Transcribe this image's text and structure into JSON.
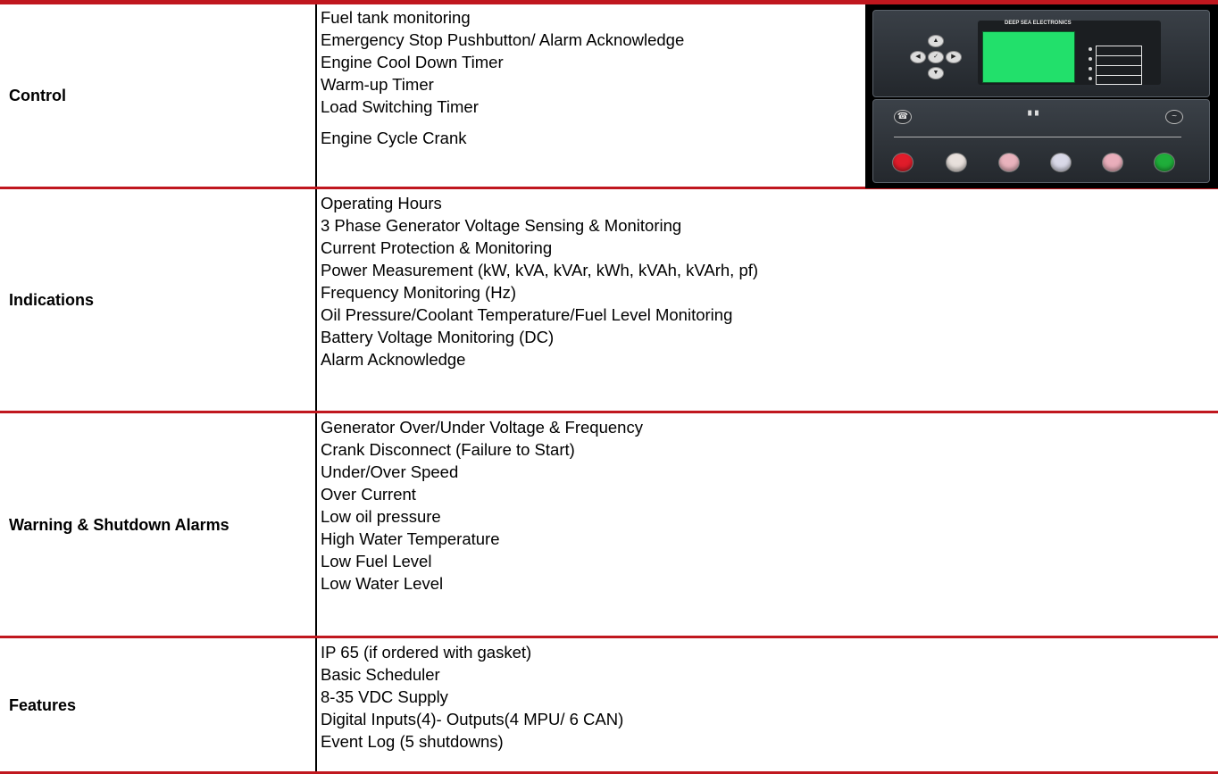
{
  "categories": [
    {
      "label": "Control",
      "items": [
        "Fuel tank monitoring",
        "Emergency Stop Pushbutton/ Alarm Acknowledge",
        "Engine Cool Down Timer",
        "Warm-up Timer",
        "Load Switching Timer",
        "Engine Cycle Crank"
      ]
    },
    {
      "label": "Indications",
      "items": [
        "Operating Hours",
        "3 Phase Generator Voltage Sensing & Monitoring",
        "Current Protection & Monitoring",
        "Power Measurement (kW, kVA, kVAr, kWh, kVAh, kVArh, pf)",
        "Frequency Monitoring (Hz)",
        "Oil Pressure/Coolant Temperature/Fuel Level Monitoring",
        "Battery Voltage Monitoring (DC)",
        "Alarm Acknowledge"
      ]
    },
    {
      "label": "Warning & Shutdown Alarms",
      "items": [
        "Generator Over/Under Voltage & Frequency",
        "Crank Disconnect (Failure to Start)",
        "Under/Over Speed",
        "Over Current",
        "Low oil pressure",
        "High Water Temperature",
        "Low Fuel Level",
        "Low Water Level"
      ]
    },
    {
      "label": "Features",
      "items": [
        "IP 65 (if ordered with gasket)",
        "Basic Scheduler",
        "8-35 VDC Supply",
        "Digital Inputs(4)- Outputs(4 MPU/ 6 CAN)",
        "Event Log (5 shutdowns)"
      ]
    }
  ],
  "controller_image": {
    "brand_text": "DEEP SEA ELECTRONICS",
    "screen_color": "#22e06b",
    "button_colors": [
      "#e01c2a",
      "#e8e0dc",
      "#e9b3bd",
      "#d9d9e8",
      "#e9aebb",
      "#1fae3a"
    ],
    "icon_names": [
      "arrow-up-icon",
      "arrow-left-icon",
      "enter-icon",
      "arrow-right-icon",
      "arrow-down-icon",
      "generator-icon",
      "load-icon",
      "ac-wave-icon"
    ]
  },
  "colors": {
    "divider": "#c0171e"
  }
}
